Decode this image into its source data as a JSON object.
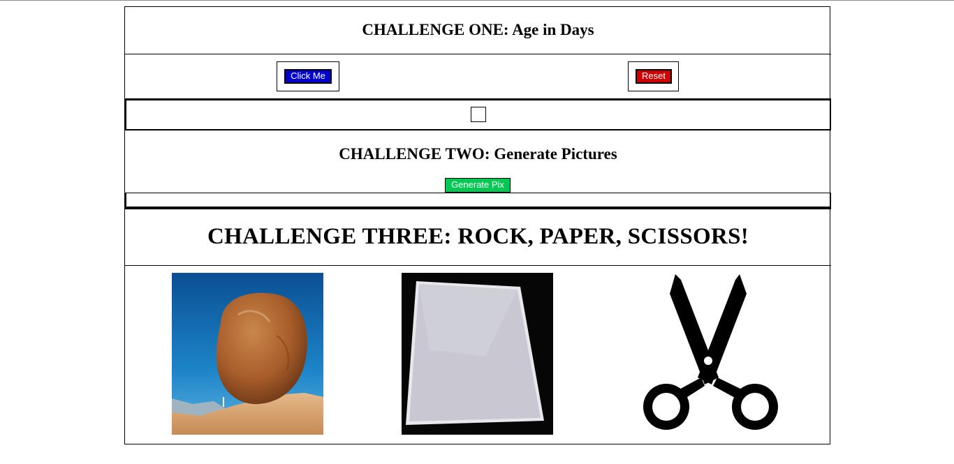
{
  "challenge_one": {
    "title": "CHALLENGE ONE: Age in Days",
    "click_button_label": "Click Me",
    "reset_button_label": "Reset",
    "click_button_color": "#0000cc",
    "reset_button_color": "#cc0000"
  },
  "challenge_two": {
    "title": "CHALLENGE TWO: Generate Pictures",
    "generate_button_label": "Generate Pix",
    "generate_button_color": "#00c853"
  },
  "challenge_three": {
    "title": "CHALLENGE THREE: ROCK, PAPER, SCISSORS!",
    "choices": [
      {
        "name": "rock",
        "icon": "rock-image"
      },
      {
        "name": "paper",
        "icon": "paper-image"
      },
      {
        "name": "scissors",
        "icon": "scissors-icon"
      }
    ]
  }
}
